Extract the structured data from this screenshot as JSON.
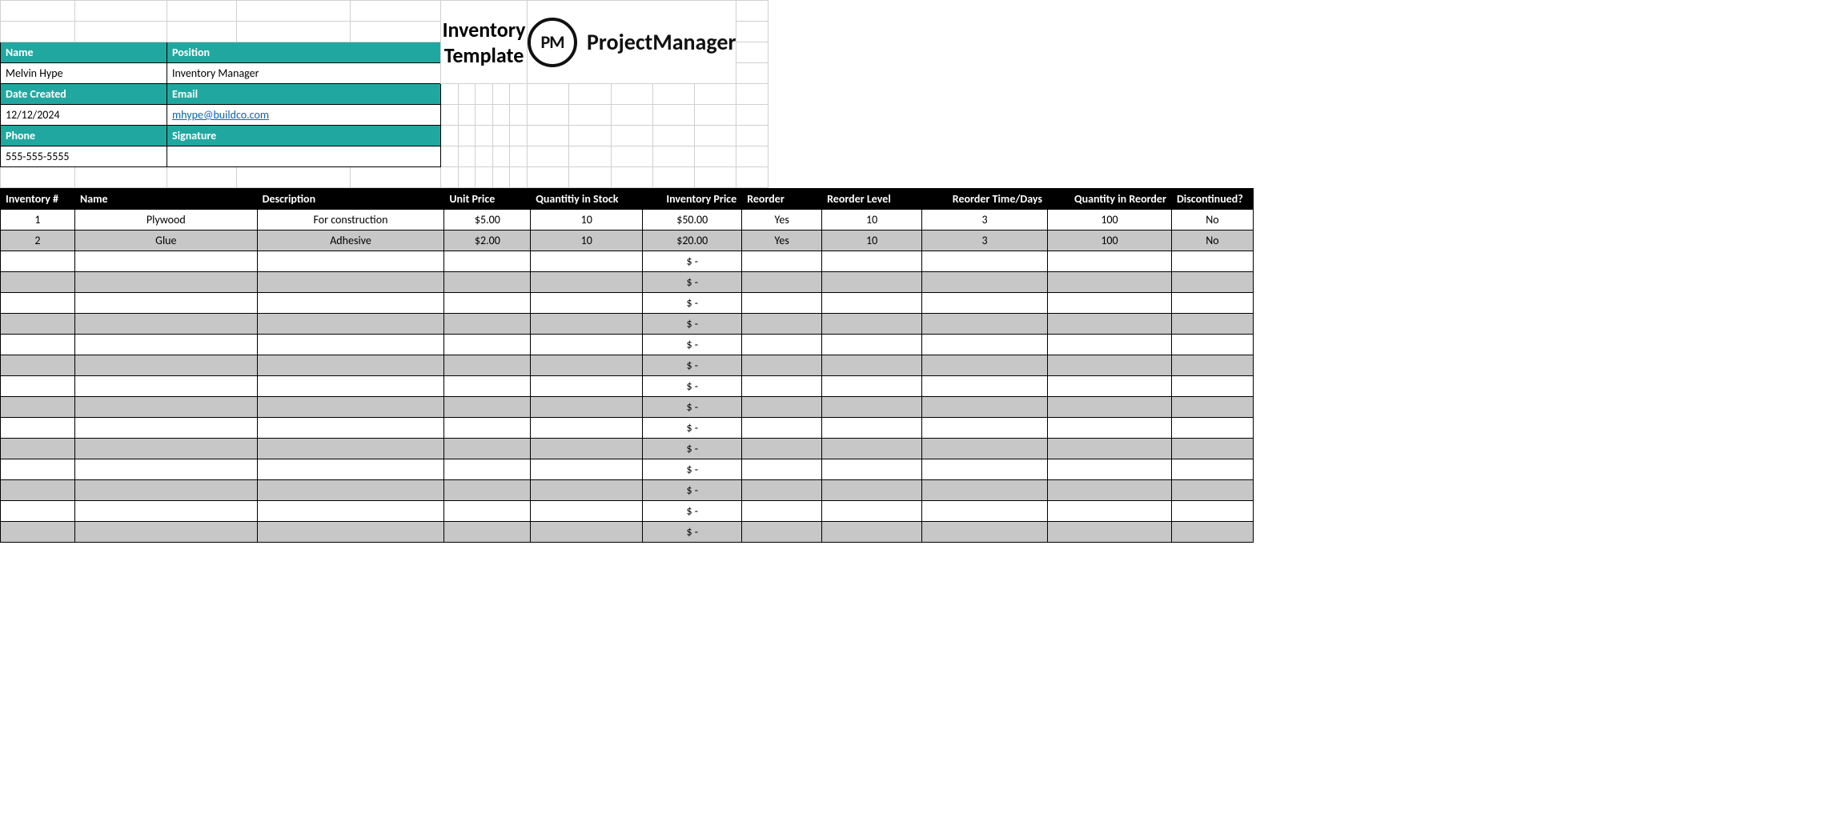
{
  "title": "Inventory Template",
  "brand": {
    "logo_text": "PM",
    "name": "ProjectManager"
  },
  "info": {
    "labels": {
      "name": "Name",
      "position": "Position",
      "date": "Date Created",
      "email": "Email",
      "phone": "Phone",
      "signature": "Signature"
    },
    "name": "Melvin Hype",
    "position": "Inventory Manager",
    "date": "12/12/2024",
    "email": "mhype@buildco.com",
    "phone": "555-555-5555",
    "signature": ""
  },
  "columns": {
    "num": "Inventory #",
    "name": "Name",
    "desc": "Description",
    "price": "Unit Price",
    "qty": "Quantitiy in Stock",
    "invp": "Inventory Price",
    "reo": "Reorder",
    "relvl": "Reorder Level",
    "redays": "Reorder Time/Days",
    "reqty": "Quantity in Reorder",
    "disc": "Discontinued?"
  },
  "rows": [
    {
      "num": "1",
      "name": "Plywood",
      "desc": "For construction",
      "price": "$5.00",
      "qty": "10",
      "invp": "$50.00",
      "reo": "Yes",
      "relvl": "10",
      "redays": "3",
      "reqty": "100",
      "disc": "No"
    },
    {
      "num": "2",
      "name": "Glue",
      "desc": "Adhesive",
      "price": "$2.00",
      "qty": "10",
      "invp": "$20.00",
      "reo": "Yes",
      "relvl": "10",
      "redays": "3",
      "reqty": "100",
      "disc": "No"
    }
  ],
  "empty_placeholder": "$  -",
  "empty_rows": 14
}
